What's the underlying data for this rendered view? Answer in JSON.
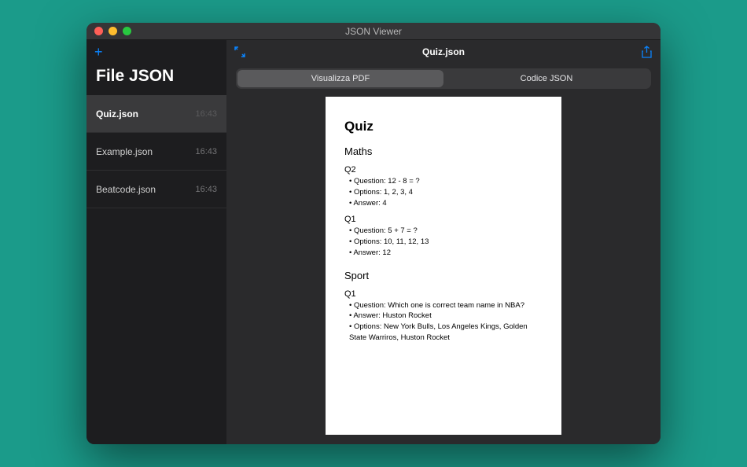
{
  "window": {
    "title": "JSON Viewer"
  },
  "sidebar": {
    "header": "File JSON",
    "items": [
      {
        "name": "Quiz.json",
        "time": "16:43",
        "selected": true
      },
      {
        "name": "Example.json",
        "time": "16:43",
        "selected": false
      },
      {
        "name": "Beatcode.json",
        "time": "16:43",
        "selected": false
      }
    ]
  },
  "main": {
    "filename": "Quiz.json",
    "tabs": {
      "pdf": "Visualizza PDF",
      "json": "Codice JSON"
    }
  },
  "document": {
    "title": "Quiz",
    "sections": [
      {
        "name": "Maths",
        "questions": [
          {
            "id": "Q2",
            "question": "Question: 12 - 8 = ?",
            "options": "Options: 1, 2, 3, 4",
            "answer": "Answer: 4"
          },
          {
            "id": "Q1",
            "question": "Question: 5 + 7 = ?",
            "options": "Options: 10, 11, 12, 13",
            "answer": "Answer: 12"
          }
        ]
      },
      {
        "name": "Sport",
        "questions": [
          {
            "id": "Q1",
            "question": "Question: Which one is correct team name in NBA?",
            "answer": "Answer: Huston Rocket",
            "options": "Options: New York Bulls, Los Angeles Kings, Golden State Warriros, Huston Rocket"
          }
        ]
      }
    ]
  }
}
